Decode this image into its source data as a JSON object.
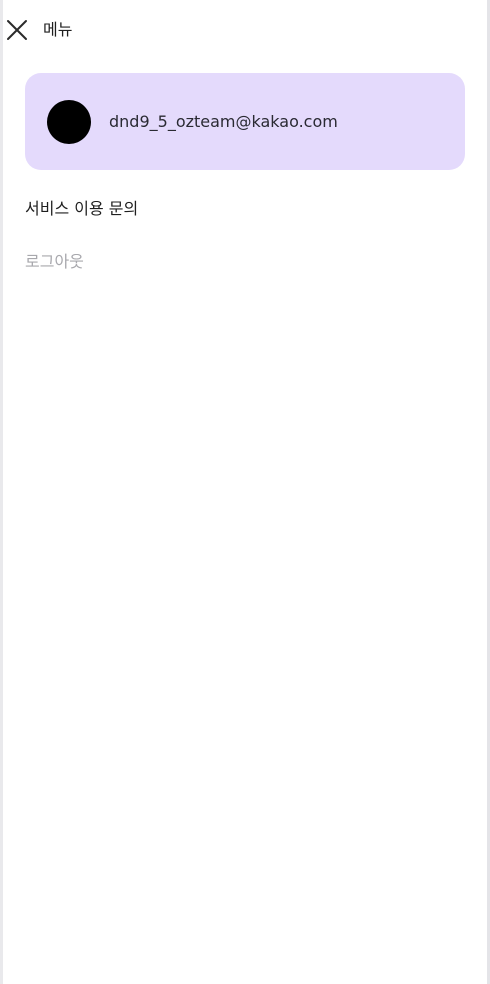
{
  "header": {
    "title": "메뉴",
    "close_icon": "close-icon"
  },
  "profile": {
    "email": "dnd9_5_ozteam@kakao.com",
    "avatar_color": "#000000",
    "card_color": "#e4dafc"
  },
  "menu": {
    "items": [
      {
        "label": "서비스 이용 문의"
      },
      {
        "label": "로그아웃"
      }
    ]
  }
}
